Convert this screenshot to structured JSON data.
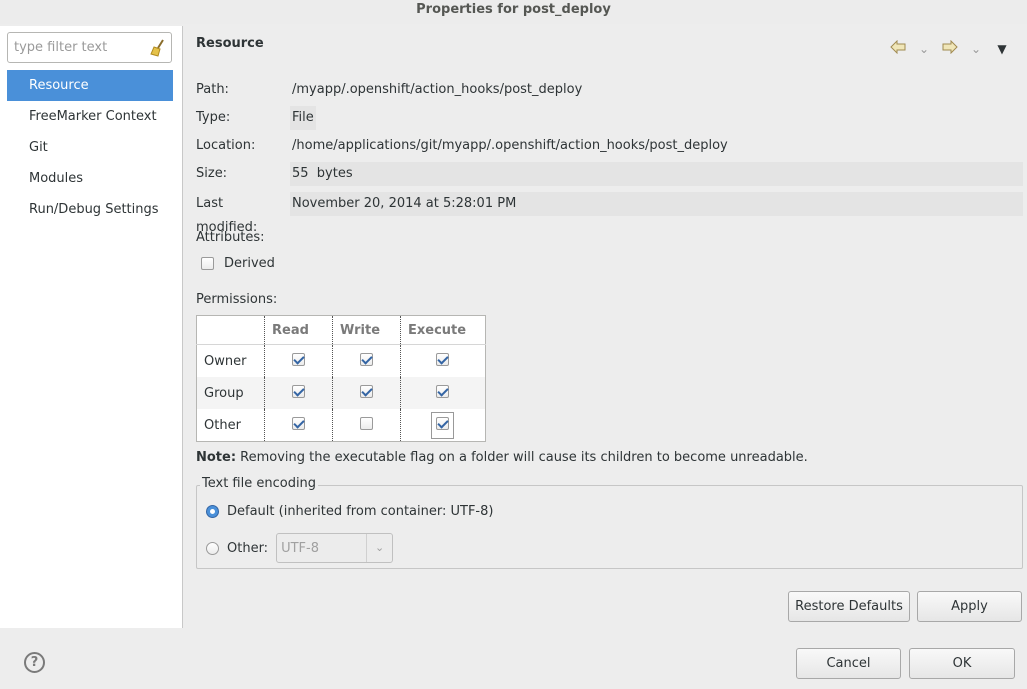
{
  "window": {
    "title": "Properties for post_deploy"
  },
  "sidebar": {
    "filter_placeholder": "type filter text",
    "items": [
      {
        "label": "Resource",
        "active": true
      },
      {
        "label": "FreeMarker Context",
        "active": false
      },
      {
        "label": "Git",
        "active": false
      },
      {
        "label": "Modules",
        "active": false
      },
      {
        "label": "Run/Debug Settings",
        "active": false
      }
    ]
  },
  "panel": {
    "title": "Resource",
    "fields": [
      {
        "label": "Path:",
        "value": "/myapp/.openshift/action_hooks/post_deploy"
      },
      {
        "label": "Type:",
        "value": "File"
      },
      {
        "label": "Location:",
        "value": "/home/applications/git/myapp/.openshift/action_hooks/post_deploy"
      },
      {
        "label": "Size:",
        "value": "55  bytes"
      },
      {
        "label": "Last modified:",
        "value": "November 20, 2014 at 5:28:01 PM"
      }
    ],
    "attributes_label": "Attributes:",
    "derived_label": "Derived",
    "derived_checked": false,
    "permissions_label": "Permissions:",
    "permissions": {
      "headers": [
        "",
        "Read",
        "Write",
        "Execute"
      ],
      "rows": [
        {
          "label": "Owner",
          "read": true,
          "write": true,
          "execute": true
        },
        {
          "label": "Group",
          "read": true,
          "write": true,
          "execute": true
        },
        {
          "label": "Other",
          "read": true,
          "write": false,
          "execute": true
        }
      ]
    },
    "note_bold": "Note:",
    "note_text": " Removing the executable flag on a folder will cause its children to become unreadable.",
    "encoding": {
      "legend": "Text file encoding",
      "default_label": "Default (inherited from container: UTF-8)",
      "other_label": "Other:",
      "other_value": "UTF-8",
      "selected": "default"
    },
    "restore_defaults": "Restore Defaults",
    "apply": "Apply"
  },
  "footer": {
    "help_glyph": "?",
    "cancel": "Cancel",
    "ok": "OK"
  }
}
